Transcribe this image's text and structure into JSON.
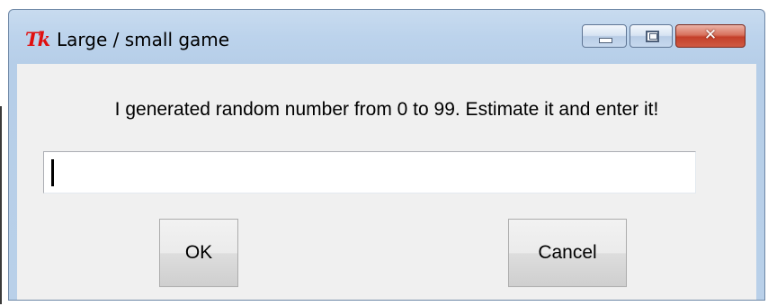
{
  "window": {
    "title": "Large / small game",
    "app_icon": "Tk",
    "controls": {
      "minimize": "minimize-icon",
      "maximize": "maximize-icon",
      "close": "close-icon"
    }
  },
  "dialog": {
    "message": "I generated random number from 0 to 99. Estimate it and enter it!",
    "input_value": "",
    "ok_label": "OK",
    "cancel_label": "Cancel"
  },
  "colors": {
    "title_bar": "#bcd3ec",
    "client_background": "#f0f0f0",
    "close_button": "#c4402a",
    "app_icon": "#e01010"
  }
}
